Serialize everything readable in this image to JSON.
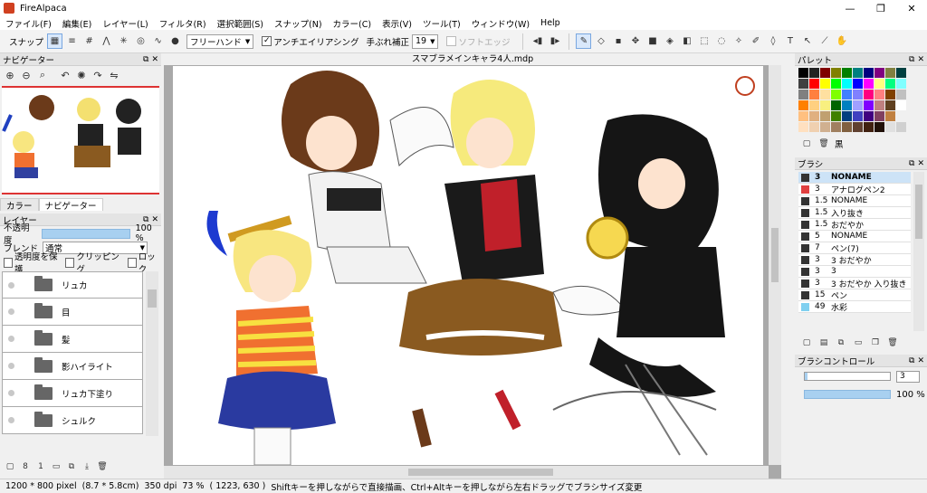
{
  "window": {
    "title": "FireAlpaca",
    "controls": [
      "—",
      "❐",
      "✕"
    ]
  },
  "menu": [
    "ファイル(F)",
    "編集(E)",
    "レイヤー(L)",
    "フィルタ(R)",
    "選択範囲(S)",
    "スナップ(N)",
    "カラー(C)",
    "表示(V)",
    "ツール(T)",
    "ウィンドウ(W)",
    "Help"
  ],
  "toolbar": {
    "snap_label": "スナップ",
    "snap_icons": [
      "snap-off-icon",
      "snap-parallel-icon",
      "snap-crisscross-icon",
      "snap-vanishing-icon",
      "snap-radial-icon",
      "snap-circle-icon",
      "snap-curve-icon"
    ],
    "stroke_mode": "フリーハンド",
    "antialias_label": "アンチエイリアシング",
    "antialias_checked": true,
    "stabilizer_label": "手ぶれ補正",
    "stabilizer_value": "19",
    "soft_edge_label": "ソフトエッジ",
    "soft_edge_checked": false
  },
  "navigator": {
    "title": "ナビゲーター",
    "tools": [
      "zoom-in-icon",
      "zoom-out-icon",
      "zoom-fit-icon",
      "rotate-left-icon",
      "rotate-reset-icon",
      "rotate-right-icon",
      "flip-icon"
    ],
    "tabs": [
      "カラー",
      "ナビゲーター"
    ],
    "active_tab": 1
  },
  "layers_panel": {
    "title": "レイヤー",
    "opacity_label": "不透明度",
    "opacity_value": "100 %",
    "opacity_fraction": 1.0,
    "blend_label": "ブレンド",
    "blend_value": "通常",
    "protect_alpha_label": "透明度を保護",
    "clipping_label": "クリッピング",
    "lock_label": "ロック",
    "layers": [
      {
        "name": "リュカ"
      },
      {
        "name": "目"
      },
      {
        "name": "髪"
      },
      {
        "name": "影ハイライト"
      },
      {
        "name": "リュカ下塗り"
      },
      {
        "name": "シュルク"
      }
    ],
    "bottom_icons": [
      "new-layer-icon",
      "new-8bit-layer-icon",
      "new-1bit-layer-icon",
      "new-folder-icon",
      "duplicate-layer-icon",
      "merge-down-icon",
      "delete-layer-icon"
    ]
  },
  "document": {
    "tab_title": "スマブラメインキャラ4人.mdp"
  },
  "palette": {
    "title": "パレット",
    "colors": [
      "#000000",
      "#222222",
      "#800000",
      "#808000",
      "#008000",
      "#008080",
      "#000080",
      "#800080",
      "#808040",
      "#004040",
      "#404040",
      "#ff0000",
      "#ffff00",
      "#00ff00",
      "#00ffff",
      "#0000ff",
      "#ff00ff",
      "#ffff80",
      "#00ff80",
      "#80ffff",
      "#808080",
      "#ff8040",
      "#ffe0a0",
      "#80ff00",
      "#4080ff",
      "#8080ff",
      "#ff0080",
      "#ff8080",
      "#804000",
      "#c0c0c0",
      "#ff8000",
      "#ffd080",
      "#f8f080",
      "#006400",
      "#0080c0",
      "#a0a0ff",
      "#8000ff",
      "#c08080",
      "#604020",
      "#ffffff",
      "#ffc080",
      "#e0b080",
      "#c0a070",
      "#408000",
      "#004080",
      "#4040c0",
      "#400080",
      "#804060",
      "#c08040",
      "#f0f0f0",
      "#ffe0c0",
      "#f0d0b0",
      "#d0b090",
      "#a08060",
      "#806040",
      "#604030",
      "#402010",
      "#201008",
      "#e0e0e0",
      "#d0d0d0"
    ],
    "bottom": {
      "current_label": "黒"
    }
  },
  "brush_panel": {
    "title": "ブラシ",
    "items": [
      {
        "size": "3",
        "name": "NONAME",
        "color": "#333333",
        "selected": true
      },
      {
        "size": "3",
        "name": "アナログペン2",
        "color": "#e04040",
        "selected": false
      },
      {
        "size": "1.5",
        "name": "NONAME",
        "color": "#333333",
        "selected": false
      },
      {
        "size": "1.5",
        "name": "入り抜き",
        "color": "#333333",
        "selected": false
      },
      {
        "size": "1.5",
        "name": "おだやか",
        "color": "#333333",
        "selected": false
      },
      {
        "size": "5",
        "name": "NONAME",
        "color": "#333333",
        "selected": false
      },
      {
        "size": "7",
        "name": "ペン(7)",
        "color": "#333333",
        "selected": false
      },
      {
        "size": "3",
        "name": "3 おだやか",
        "color": "#333333",
        "selected": false
      },
      {
        "size": "3",
        "name": "3",
        "color": "#333333",
        "selected": false
      },
      {
        "size": "3",
        "name": "3 おだやか 入り抜き",
        "color": "#333333",
        "selected": false
      },
      {
        "size": "15",
        "name": "ペン",
        "color": "#333333",
        "selected": false
      },
      {
        "size": "49",
        "name": "水彩",
        "color": "#80d0f0",
        "selected": false
      }
    ]
  },
  "brush_control": {
    "title": "ブラシコントロール",
    "size_value": "3",
    "size_fraction": 0.03,
    "opacity_value": "100 %",
    "opacity_fraction": 1.0
  },
  "status": {
    "size": "1200 * 800 pixel",
    "physical": "(8.7 * 5.8cm)",
    "dpi": "350 dpi",
    "zoom": "73 %",
    "cursor": "( 1223, 630 )",
    "hint": "Shiftキーを押しながらで直接描画、Ctrl+Altキーを押しながら左右ドラッグでブラシサイズ変更"
  }
}
